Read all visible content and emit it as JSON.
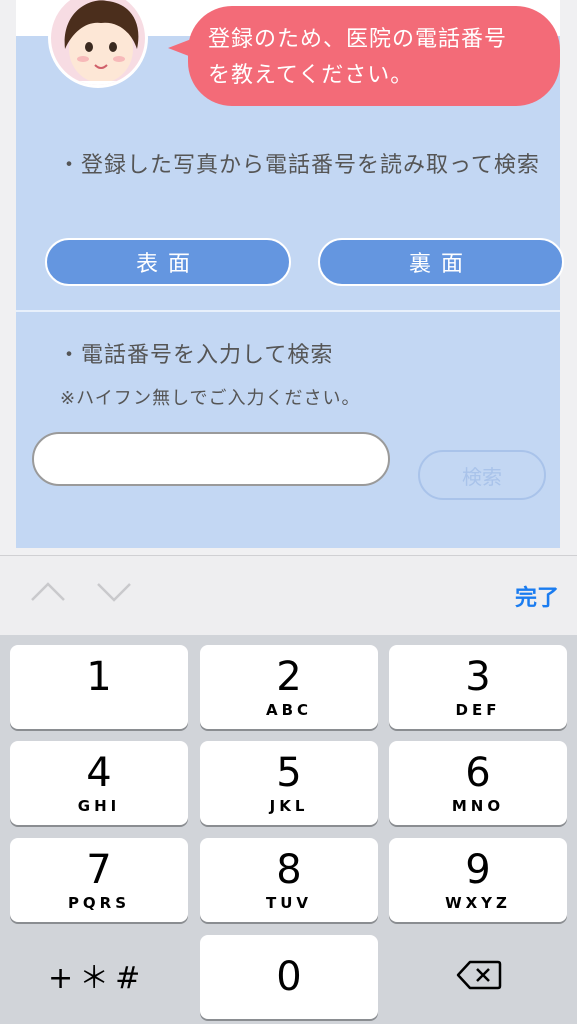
{
  "bubble": {
    "line1": "登録のため、医院の電話番号",
    "line2": "を教えてください。"
  },
  "photo_section": {
    "description": "・登録した写真から電話番号を読み取って検索",
    "front_button": "表面",
    "back_button": "裏面"
  },
  "manual_section": {
    "description": "・電話番号を入力して検索",
    "note": "※ハイフン無しでご入力ください。",
    "phone_input": {
      "value": "",
      "placeholder": ""
    },
    "search_button": "検索"
  },
  "accessory": {
    "done_label": "完了",
    "prev_icon": "chevron-up-icon",
    "next_icon": "chevron-down-icon"
  },
  "keypad": {
    "keys": [
      {
        "num": "1",
        "letters": ""
      },
      {
        "num": "2",
        "letters": "ABC"
      },
      {
        "num": "3",
        "letters": "DEF"
      },
      {
        "num": "4",
        "letters": "GHI"
      },
      {
        "num": "5",
        "letters": "JKL"
      },
      {
        "num": "6",
        "letters": "MNO"
      },
      {
        "num": "7",
        "letters": "PQRS"
      },
      {
        "num": "8",
        "letters": "TUV"
      },
      {
        "num": "9",
        "letters": "WXYZ"
      },
      {
        "num": "0",
        "letters": ""
      }
    ],
    "symbols": "+＊#",
    "backspace_icon": "backspace-icon"
  },
  "colors": {
    "bubble": "#f36b78",
    "card": "#c3d7f3",
    "button": "#6496e0",
    "done": "#1a7cf0"
  }
}
